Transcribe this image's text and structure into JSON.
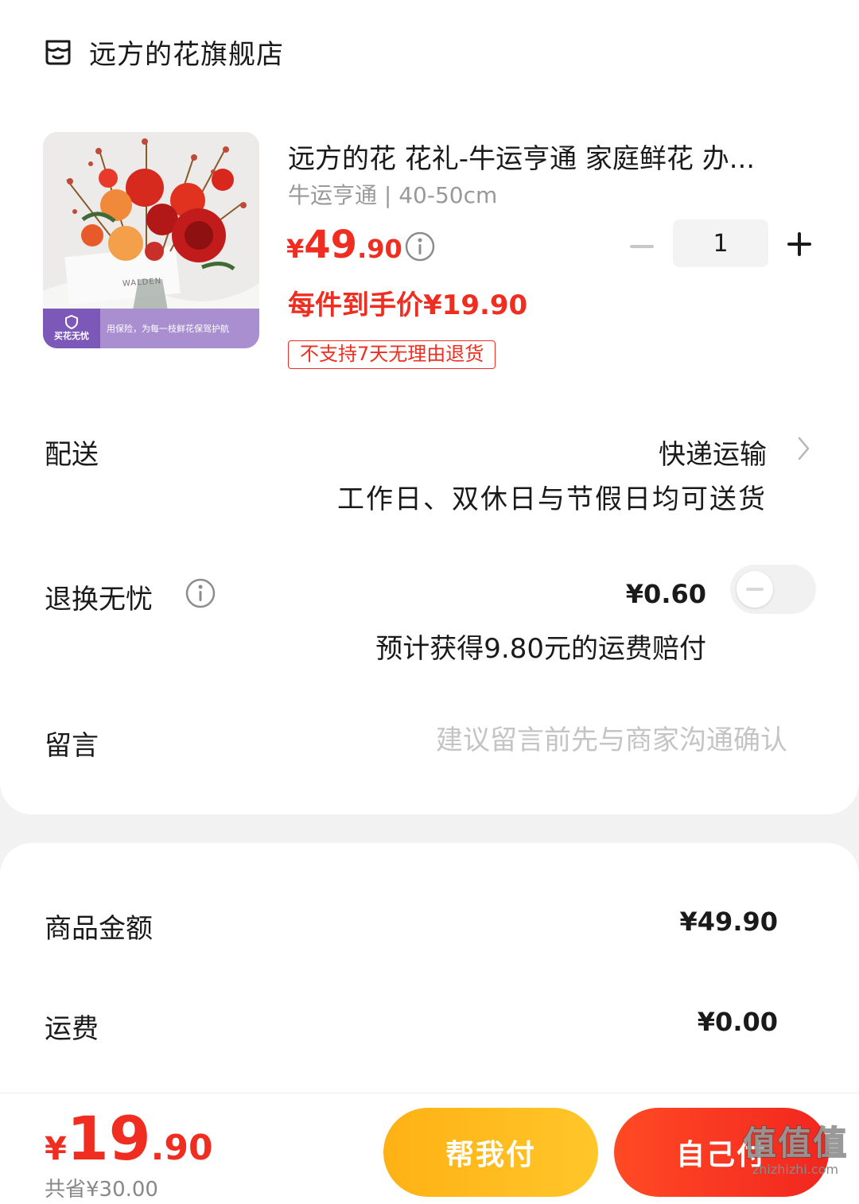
{
  "store": {
    "name": "远方的花旗舰店",
    "icon": "store-icon"
  },
  "product": {
    "title": "远方的花 花礼-牛运亨通 家庭鲜花 办...",
    "spec": "牛运亨通 | 40-50cm",
    "price": {
      "currency": "¥",
      "integer": "49",
      "decimal": ".90"
    },
    "quantity": "1",
    "per_item_price": "每件到手价¥19.90",
    "tag": "不支持7天无理由退货",
    "image": {
      "badge_text": "买花无忧",
      "banner_text": "用保险，为每一枝鲜花保驾护航",
      "vase_label": "WALDEN"
    }
  },
  "delivery": {
    "label": "配送",
    "method": "快递运输",
    "description": "工作日、双休日与节假日均可送货"
  },
  "return_insurance": {
    "label": "退换无忧",
    "price": "¥0.60",
    "description": "预计获得9.80元的运费赔付",
    "enabled": false
  },
  "message": {
    "label": "留言",
    "placeholder": "建议留言前先与商家沟通确认"
  },
  "summary": {
    "goods_label": "商品金额",
    "goods_value": "¥49.90",
    "shipping_label": "运费",
    "shipping_value": "¥0.00"
  },
  "footer": {
    "total": {
      "currency": "¥",
      "integer": "19",
      "decimal": ".90"
    },
    "saved": "共省¥30.00",
    "help_pay_label": "帮我付",
    "self_pay_label": "自己付"
  },
  "watermark": {
    "big": "值值值",
    "small": "zhizhizhi.com"
  },
  "colors": {
    "accent": "#f02d21",
    "help_btn": "#ffb114",
    "self_btn": "#f2261f"
  }
}
